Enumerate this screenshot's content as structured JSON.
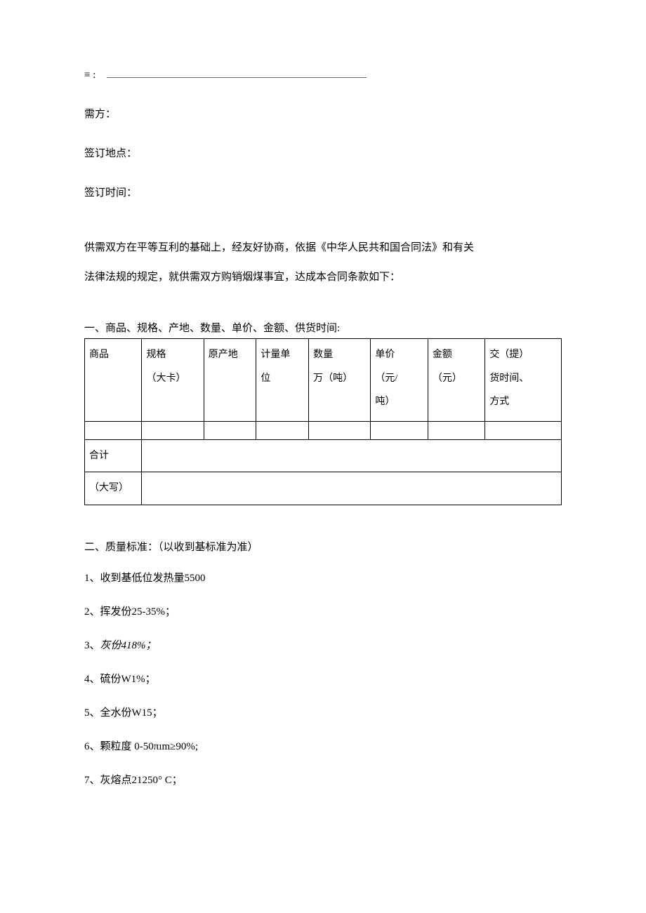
{
  "header": {
    "supplier_label": "≡ :",
    "buyer_label": "需方：",
    "sign_place_label": "签订地点：",
    "sign_time_label": "签订时间："
  },
  "intro_p1": "供需双方在平等互利的基础上，经友好协商，依据《中华人民共和国合同法》和有关",
  "intro_p2": "法律法规的规定，就供需双方购销烟煤事宜，达成本合同条款如下：",
  "section1_title": "一、商品、规格、产地、数量、单价、金额、供货时间:",
  "table": {
    "headers": {
      "c1": "商品",
      "c2_l1": "规格",
      "c2_l2": "（大卡）",
      "c3": "原产地",
      "c4_l1": "计量单",
      "c4_l2": "位",
      "c5_l1": "数量",
      "c5_l2": "万（吨）",
      "c6_l1": "单价",
      "c6_l2": "（元/",
      "c6_l3": "吨）",
      "c7_l1": "金额",
      "c7_l2": "（元）",
      "c8_l1": "交（提）",
      "c8_l2": "货时间、",
      "c8_l3": "方式"
    },
    "total_label": "合计",
    "caps_label": "（大写）"
  },
  "section2_title": "二、质量标准：（以收到基标准为准）",
  "standards": {
    "s1": "1、收到基低位发热量5500",
    "s2": "2、挥发份25-35%；",
    "s3_prefix": "3、",
    "s3_italic": "灰份418%；",
    "s4": "4、硫份W1%；",
    "s5": "5、全水份W15；",
    "s6": "6、颗粒度  0-50πım≥90%;",
    "s7": "7、灰熔点21250° C；"
  }
}
